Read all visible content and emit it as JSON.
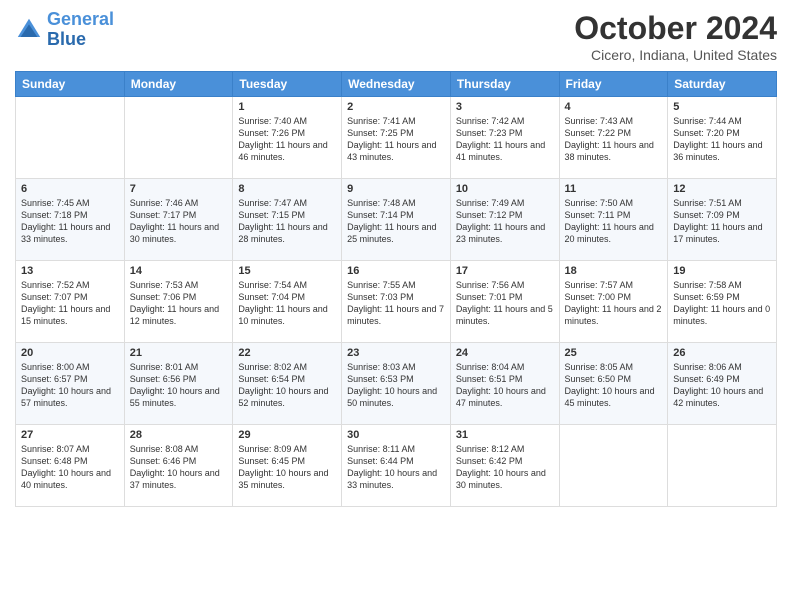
{
  "header": {
    "logo_line1": "General",
    "logo_line2": "Blue",
    "month": "October 2024",
    "location": "Cicero, Indiana, United States"
  },
  "weekdays": [
    "Sunday",
    "Monday",
    "Tuesday",
    "Wednesday",
    "Thursday",
    "Friday",
    "Saturday"
  ],
  "weeks": [
    [
      {
        "day": "",
        "info": ""
      },
      {
        "day": "",
        "info": ""
      },
      {
        "day": "1",
        "info": "Sunrise: 7:40 AM\nSunset: 7:26 PM\nDaylight: 11 hours and 46 minutes."
      },
      {
        "day": "2",
        "info": "Sunrise: 7:41 AM\nSunset: 7:25 PM\nDaylight: 11 hours and 43 minutes."
      },
      {
        "day": "3",
        "info": "Sunrise: 7:42 AM\nSunset: 7:23 PM\nDaylight: 11 hours and 41 minutes."
      },
      {
        "day": "4",
        "info": "Sunrise: 7:43 AM\nSunset: 7:22 PM\nDaylight: 11 hours and 38 minutes."
      },
      {
        "day": "5",
        "info": "Sunrise: 7:44 AM\nSunset: 7:20 PM\nDaylight: 11 hours and 36 minutes."
      }
    ],
    [
      {
        "day": "6",
        "info": "Sunrise: 7:45 AM\nSunset: 7:18 PM\nDaylight: 11 hours and 33 minutes."
      },
      {
        "day": "7",
        "info": "Sunrise: 7:46 AM\nSunset: 7:17 PM\nDaylight: 11 hours and 30 minutes."
      },
      {
        "day": "8",
        "info": "Sunrise: 7:47 AM\nSunset: 7:15 PM\nDaylight: 11 hours and 28 minutes."
      },
      {
        "day": "9",
        "info": "Sunrise: 7:48 AM\nSunset: 7:14 PM\nDaylight: 11 hours and 25 minutes."
      },
      {
        "day": "10",
        "info": "Sunrise: 7:49 AM\nSunset: 7:12 PM\nDaylight: 11 hours and 23 minutes."
      },
      {
        "day": "11",
        "info": "Sunrise: 7:50 AM\nSunset: 7:11 PM\nDaylight: 11 hours and 20 minutes."
      },
      {
        "day": "12",
        "info": "Sunrise: 7:51 AM\nSunset: 7:09 PM\nDaylight: 11 hours and 17 minutes."
      }
    ],
    [
      {
        "day": "13",
        "info": "Sunrise: 7:52 AM\nSunset: 7:07 PM\nDaylight: 11 hours and 15 minutes."
      },
      {
        "day": "14",
        "info": "Sunrise: 7:53 AM\nSunset: 7:06 PM\nDaylight: 11 hours and 12 minutes."
      },
      {
        "day": "15",
        "info": "Sunrise: 7:54 AM\nSunset: 7:04 PM\nDaylight: 11 hours and 10 minutes."
      },
      {
        "day": "16",
        "info": "Sunrise: 7:55 AM\nSunset: 7:03 PM\nDaylight: 11 hours and 7 minutes."
      },
      {
        "day": "17",
        "info": "Sunrise: 7:56 AM\nSunset: 7:01 PM\nDaylight: 11 hours and 5 minutes."
      },
      {
        "day": "18",
        "info": "Sunrise: 7:57 AM\nSunset: 7:00 PM\nDaylight: 11 hours and 2 minutes."
      },
      {
        "day": "19",
        "info": "Sunrise: 7:58 AM\nSunset: 6:59 PM\nDaylight: 11 hours and 0 minutes."
      }
    ],
    [
      {
        "day": "20",
        "info": "Sunrise: 8:00 AM\nSunset: 6:57 PM\nDaylight: 10 hours and 57 minutes."
      },
      {
        "day": "21",
        "info": "Sunrise: 8:01 AM\nSunset: 6:56 PM\nDaylight: 10 hours and 55 minutes."
      },
      {
        "day": "22",
        "info": "Sunrise: 8:02 AM\nSunset: 6:54 PM\nDaylight: 10 hours and 52 minutes."
      },
      {
        "day": "23",
        "info": "Sunrise: 8:03 AM\nSunset: 6:53 PM\nDaylight: 10 hours and 50 minutes."
      },
      {
        "day": "24",
        "info": "Sunrise: 8:04 AM\nSunset: 6:51 PM\nDaylight: 10 hours and 47 minutes."
      },
      {
        "day": "25",
        "info": "Sunrise: 8:05 AM\nSunset: 6:50 PM\nDaylight: 10 hours and 45 minutes."
      },
      {
        "day": "26",
        "info": "Sunrise: 8:06 AM\nSunset: 6:49 PM\nDaylight: 10 hours and 42 minutes."
      }
    ],
    [
      {
        "day": "27",
        "info": "Sunrise: 8:07 AM\nSunset: 6:48 PM\nDaylight: 10 hours and 40 minutes."
      },
      {
        "day": "28",
        "info": "Sunrise: 8:08 AM\nSunset: 6:46 PM\nDaylight: 10 hours and 37 minutes."
      },
      {
        "day": "29",
        "info": "Sunrise: 8:09 AM\nSunset: 6:45 PM\nDaylight: 10 hours and 35 minutes."
      },
      {
        "day": "30",
        "info": "Sunrise: 8:11 AM\nSunset: 6:44 PM\nDaylight: 10 hours and 33 minutes."
      },
      {
        "day": "31",
        "info": "Sunrise: 8:12 AM\nSunset: 6:42 PM\nDaylight: 10 hours and 30 minutes."
      },
      {
        "day": "",
        "info": ""
      },
      {
        "day": "",
        "info": ""
      }
    ]
  ]
}
